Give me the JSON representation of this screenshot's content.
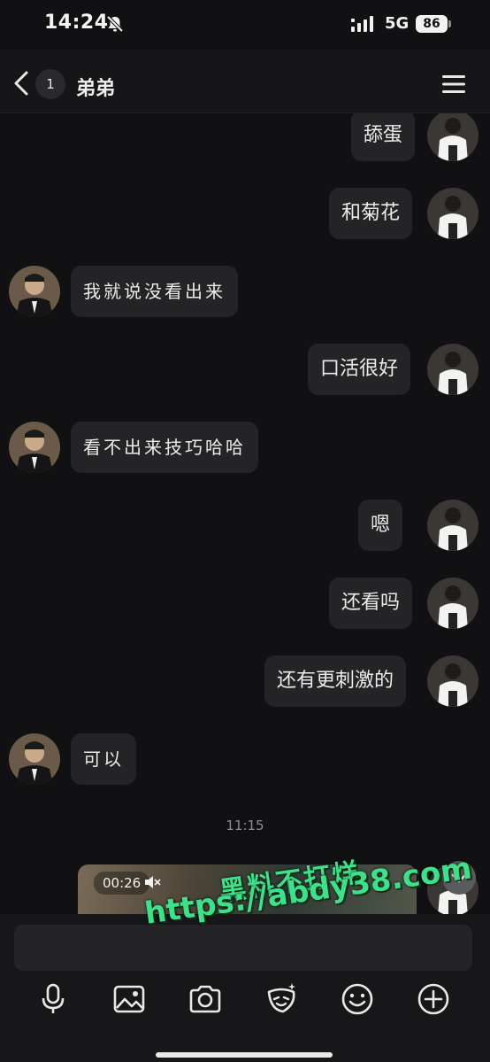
{
  "status_bar": {
    "time": "14:24",
    "network": "5G",
    "battery": "86"
  },
  "header": {
    "back_badge": "1",
    "title": "弟弟"
  },
  "messages": [
    {
      "side": "out",
      "text": "舔蛋"
    },
    {
      "side": "out",
      "text": "和菊花"
    },
    {
      "side": "in",
      "text": "我就说没看出来"
    },
    {
      "side": "out",
      "text": "口活很好"
    },
    {
      "side": "in",
      "text": "看不出来技巧哈哈"
    },
    {
      "side": "out",
      "text": "嗯"
    },
    {
      "side": "out",
      "text": "还看吗"
    },
    {
      "side": "out",
      "text": "还有更刺激的"
    },
    {
      "side": "in",
      "text": "可以"
    }
  ],
  "timestamp": "11:15",
  "video": {
    "duration": "00:26"
  },
  "watermark": {
    "line1": "黑料不打烊",
    "line2": "https://abdy38.com"
  },
  "icons": [
    "back-chevron-icon",
    "menu-icon",
    "microphone-icon",
    "image-icon",
    "camera-icon",
    "sticker-icon",
    "emoji-icon",
    "plus-circle-icon",
    "chevron-down-icon",
    "mute-icon",
    "bell-off-icon",
    "signal-icon"
  ],
  "colors": {
    "background": "#111113",
    "bubble": "#242427",
    "watermark": "#3ee08a"
  }
}
